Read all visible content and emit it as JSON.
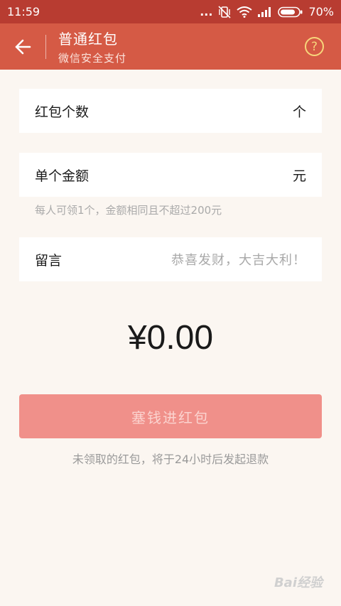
{
  "status_bar": {
    "time": "11:59",
    "dots": "...",
    "battery_percent": "70%",
    "icons": [
      "mute-vibrate-icon",
      "wifi-icon",
      "signal-icon",
      "battery-icon"
    ]
  },
  "header": {
    "back_icon": "back-arrow-icon",
    "title": "普通红包",
    "subtitle": "微信安全支付",
    "help_symbol": "?"
  },
  "form": {
    "count": {
      "label": "红包个数",
      "unit": "个"
    },
    "amount": {
      "label": "单个金额",
      "unit": "元"
    },
    "amount_note": "每人可领1个，金额相同且不超过200元",
    "message": {
      "label": "留言",
      "placeholder": "恭喜发财，大吉大利！"
    }
  },
  "total": "¥0.00",
  "submit_label": "塞钱进红包",
  "refund_note": "未领取的红包，将于24小时后发起退款",
  "watermark": "Bai经验",
  "colors": {
    "status_bar": "#b83c31",
    "title_bar": "#d55a45",
    "button": "#f0908a",
    "background": "#fbf6f1"
  }
}
